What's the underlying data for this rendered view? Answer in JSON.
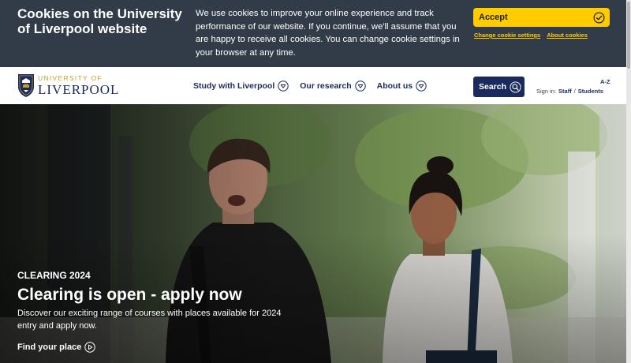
{
  "cookie_banner": {
    "title": "Cookies on the University of Liverpool website",
    "message": "We use cookies to improve your online experience and track performance of our website. If you continue, we'll assume that you are happy to receive all cookies. You can change cookie settings in your browser at any time.",
    "accept_label": "Accept",
    "accept_icon": "check-circle-icon",
    "settings_link": "Change cookie settings",
    "about_link": "About cookies",
    "colors": {
      "background": "#323c48",
      "accent": "#ffcc00"
    }
  },
  "header": {
    "logo": {
      "small_text": "UNIVERSITY OF",
      "big_text": "LIVERPOOL",
      "icon": "university-crest-icon"
    },
    "nav": [
      {
        "label": "Study with Liverpool",
        "icon": "chevron-down-icon"
      },
      {
        "label": "Our research",
        "icon": "chevron-down-icon"
      },
      {
        "label": "About us",
        "icon": "chevron-down-icon"
      }
    ],
    "search_label": "Search",
    "search_icon": "search-icon",
    "az_label": "A-Z",
    "signin": {
      "prefix": "Sign in:",
      "staff": "Staff",
      "separator": "/",
      "students": "Students"
    },
    "colors": {
      "brand": "#1a2a5e",
      "gold": "#c8a022"
    }
  },
  "hero": {
    "eyebrow": "CLEARING 2024",
    "title": "Clearing is open - apply now",
    "description": "Discover our exciting range of courses with places available for 2024 entry and apply now.",
    "cta_label": "Find your place",
    "cta_icon": "play-circle-icon"
  }
}
